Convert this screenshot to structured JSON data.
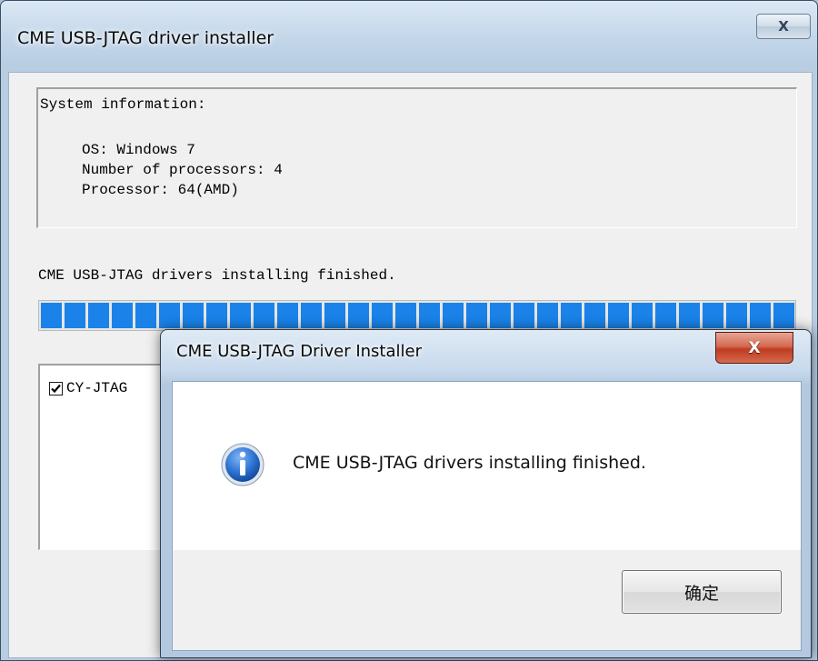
{
  "main_window": {
    "title": "CME USB-JTAG driver installer",
    "close_glyph": "X",
    "system_info": {
      "heading": "System information:",
      "lines": [
        "OS: Windows 7",
        "Number of processors: 4",
        "Processor: 64(AMD)"
      ]
    },
    "status_text": "CME USB-JTAG drivers installing finished.",
    "progress_fraction": 1.0,
    "devices": [
      {
        "label": "CY-JTAG",
        "checked": true
      }
    ]
  },
  "dialog": {
    "title": "CME USB-JTAG Driver Installer",
    "close_glyph": "X",
    "icon": "info-icon",
    "message": "CME USB-JTAG drivers installing finished.",
    "ok_label": "确定"
  },
  "colors": {
    "progress": "#1a82e8",
    "close_red": "#c1442b",
    "info_icon": "#1f66c9"
  }
}
